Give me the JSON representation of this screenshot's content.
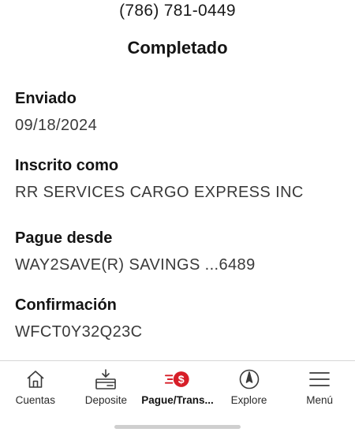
{
  "header": {
    "phone": "(786) 781-0449",
    "status": "Completado"
  },
  "details": [
    {
      "label": "Enviado",
      "value": "09/18/2024"
    },
    {
      "label": "Inscrito como",
      "value": "RR SERVICES CARGO EXPRESS INC"
    },
    {
      "label": "Pague desde",
      "value": "WAY2SAVE(R) SAVINGS ...6489"
    },
    {
      "label": "Confirmación",
      "value": "WFCT0Y32Q23C"
    }
  ],
  "tabs": [
    {
      "label": "Cuentas",
      "icon": "home-icon"
    },
    {
      "label": "Deposite",
      "icon": "deposit-icon"
    },
    {
      "label": "Pague/Trans...",
      "icon": "pay-transfer-icon",
      "active": true
    },
    {
      "label": "Explore",
      "icon": "compass-icon"
    },
    {
      "label": "Menú",
      "icon": "hamburger-menu-icon"
    }
  ],
  "colors": {
    "accent": "#d71e28",
    "text": "#141414",
    "divider": "#d6d6d6"
  }
}
